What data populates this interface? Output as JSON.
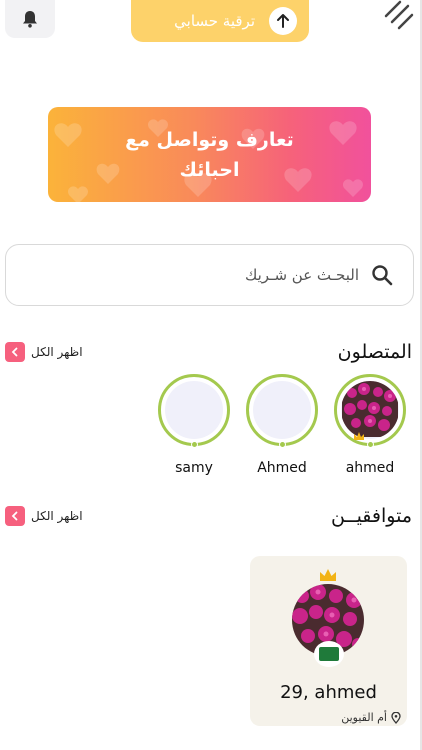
{
  "header": {
    "upgrade_label": "ترقية حسابي",
    "icons": {
      "bell": "bell-icon",
      "upgrade": "arrow-up-icon",
      "menu": "menu-lines-icon"
    }
  },
  "banner": {
    "line1": "تعارف وتواصل مع",
    "line2": "احبائك",
    "colors": [
      "#fbb33a",
      "#f98a5a",
      "#f6627a",
      "#f1519c"
    ]
  },
  "search": {
    "placeholder": "البحـث عن شـريك",
    "icon": "search-icon"
  },
  "connected": {
    "title": "المتصلون",
    "show_all": "اظهر الكل",
    "users": [
      {
        "name": "ahmed",
        "has_photo": true
      },
      {
        "name": "Ahmed",
        "has_photo": false
      },
      {
        "name": "samy",
        "has_photo": false
      }
    ]
  },
  "matches": {
    "title": "متوافقيــن",
    "show_all": "اظهر الكل",
    "cards": [
      {
        "name_age": "29, ahmed",
        "location": "أم القيوين",
        "premium": true,
        "flag": "Saudi Arabia"
      }
    ]
  },
  "colors": {
    "accent_pink": "#f6607e",
    "upgrade_yellow": "#fdd26a",
    "online_green": "#a4c94e"
  }
}
